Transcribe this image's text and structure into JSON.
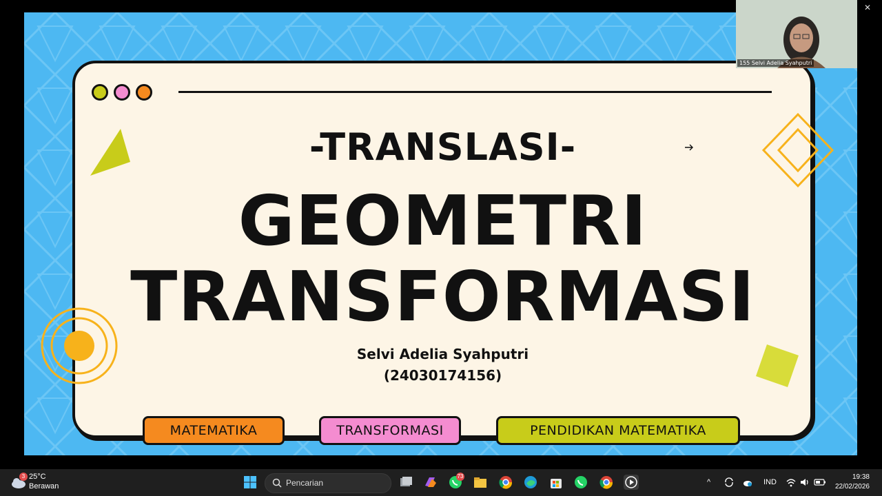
{
  "slide": {
    "subtitle": "-TRANSLASI-",
    "title_line1": "GEOMETRI",
    "title_line2": "TRANSFORMASI",
    "author_name": "Selvi Adelia Syahputri",
    "author_id": "(24030174156)",
    "tags": [
      "MATEMATIKA",
      "TRANSFORMASI",
      "PENDIDIKAN MATEMATIKA"
    ],
    "colors": {
      "background": "#4db8f2",
      "card": "#fdf5e6",
      "tag_orange": "#f58a1f",
      "tag_pink": "#f48cd0",
      "tag_olive": "#c8cc1a",
      "dot_olive": "#c8cc1a",
      "dot_pink": "#f48cd0",
      "dot_orange": "#f58a1f",
      "accent_yellow": "#f7b21b"
    }
  },
  "video_tile": {
    "participant_name": "155 Selvi Adelia Syahputri"
  },
  "window_controls": {
    "minimize": "—",
    "restore": "❐",
    "close": "✕"
  },
  "taskbar": {
    "weather": {
      "temp": "25°C",
      "condition": "Berawan",
      "badge": "3"
    },
    "search_placeholder": "Pencarian",
    "whatsapp_badge": "73",
    "tray_language": "IND",
    "time": "19:38",
    "date": "22/02/2026",
    "icons": [
      "start-icon",
      "search-icon",
      "task-view-icon",
      "copilot-icon",
      "whatsapp-icon",
      "file-explorer-icon",
      "chrome-icon",
      "edge-icon",
      "store-icon",
      "whatsapp-icon",
      "chrome-icon",
      "media-player-icon"
    ]
  }
}
